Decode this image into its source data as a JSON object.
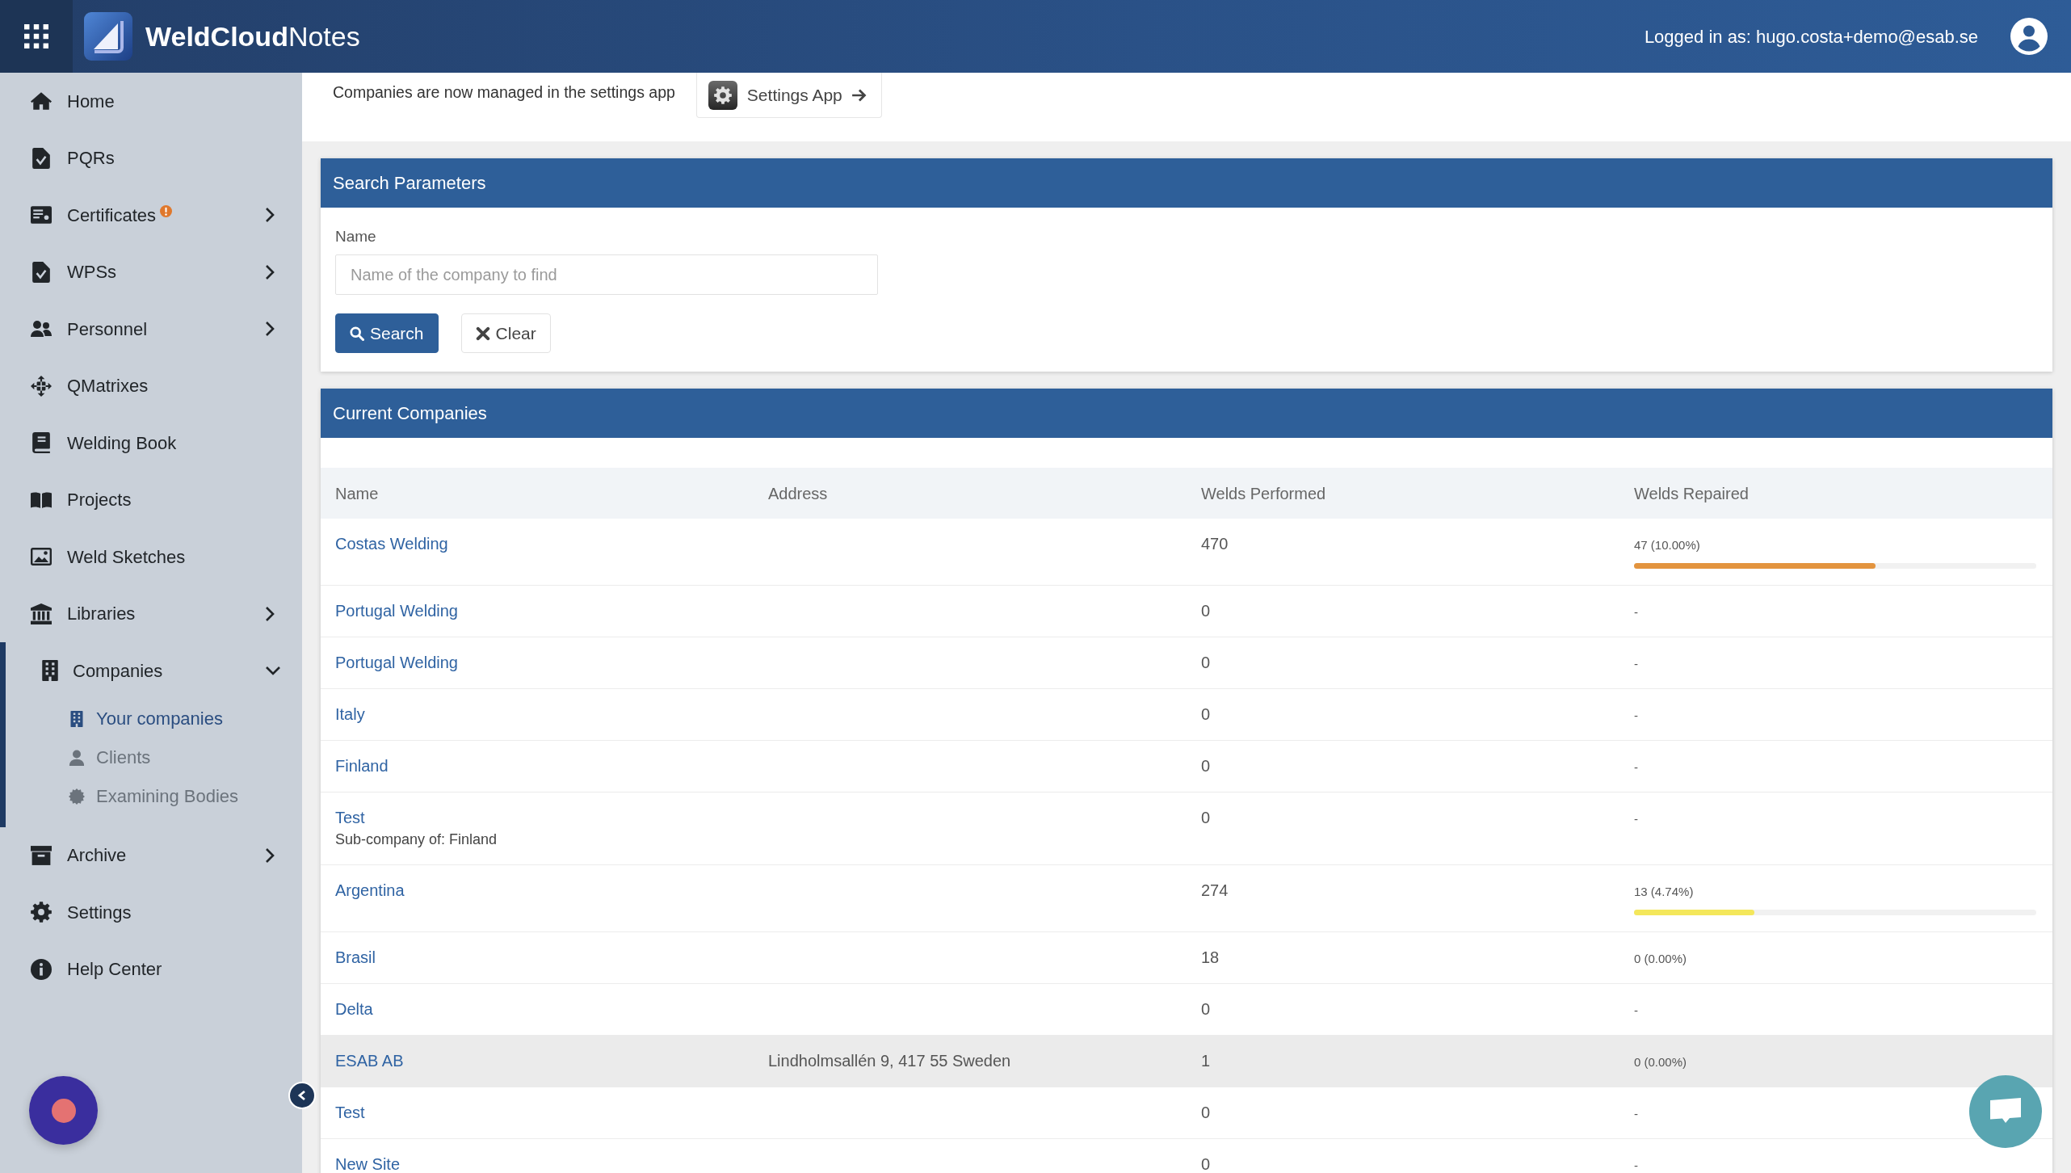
{
  "topbar": {
    "brand": "**WeldCloud**Notes",
    "user": "Logged in as: hugo.costa+demo@esab.se"
  },
  "sidebar": {
    "items": [
      {
        "label": "Home",
        "kind": "link",
        "selected": false,
        "alert": false
      },
      {
        "label": "PQRs",
        "kind": "link",
        "selected": false,
        "alert": false
      },
      {
        "label": "Certificates",
        "kind": "group",
        "selected": false,
        "alert": true,
        "expanded": false
      },
      {
        "label": "WPSs",
        "kind": "group",
        "selected": false,
        "alert": false,
        "expanded": false
      },
      {
        "label": "Personnel",
        "kind": "group",
        "selected": false,
        "alert": false,
        "expanded": false
      },
      {
        "label": "QMatrixes",
        "kind": "link",
        "selected": false,
        "alert": false
      },
      {
        "label": "Welding Book",
        "kind": "link",
        "selected": false,
        "alert": false
      },
      {
        "label": "Projects",
        "kind": "link",
        "selected": false,
        "alert": false
      },
      {
        "label": "Weld Sketches",
        "kind": "link",
        "selected": false,
        "alert": false
      },
      {
        "label": "Libraries",
        "kind": "group",
        "selected": false,
        "alert": false,
        "expanded": false
      },
      {
        "label": "Companies",
        "kind": "group",
        "selected": true,
        "alert": false,
        "expanded": true,
        "children": [
          {
            "label": "Your companies",
            "selected": true
          },
          {
            "label": "Clients",
            "selected": false
          },
          {
            "label": "Examining Bodies",
            "selected": false
          }
        ]
      },
      {
        "label": "Archive",
        "kind": "group",
        "selected": false,
        "alert": false,
        "expanded": false
      },
      {
        "label": "Settings",
        "kind": "link",
        "selected": false,
        "alert": false
      },
      {
        "label": "Help Center",
        "kind": "link",
        "selected": false,
        "alert": false
      }
    ]
  },
  "notice": {
    "text": "Companies are now managed in the settings app",
    "button": "Settings App"
  },
  "search_panel": {
    "title": "Search Parameters",
    "field": {
      "label": "Name",
      "placeholder": "Name of the company to find"
    },
    "buttons": [
      {
        "label": "Search",
        "kind": "primary"
      },
      {
        "label": "Clear",
        "kind": "secondary"
      }
    ]
  },
  "companies": {
    "title": "Current Companies",
    "columns": [
      "Name",
      "Address",
      "Welds Performed",
      "Welds Repaired"
    ],
    "rows": [
      {
        "name": "Costas Welding",
        "welds_performed": "470",
        "welds_repaired": {
          "text": "47 (10.00%)",
          "level": 0.6,
          "color": "#e3943f"
        },
        "highlighted": false
      },
      {
        "name": "Portugal Welding",
        "welds_performed": "0",
        "welds_repaired": {
          "text": "-"
        },
        "highlighted": false
      },
      {
        "name": "Portugal Welding",
        "welds_performed": "0",
        "welds_repaired": {
          "text": "-"
        },
        "highlighted": false
      },
      {
        "name": "Italy",
        "welds_performed": "0",
        "welds_repaired": {
          "text": "-"
        },
        "highlighted": false
      },
      {
        "name": "Finland",
        "welds_performed": "0",
        "welds_repaired": {
          "text": "-"
        },
        "highlighted": false
      },
      {
        "name": "Test",
        "subtitle": "Sub-company of: Finland",
        "welds_performed": "0",
        "welds_repaired": {
          "text": "-"
        },
        "highlighted": false
      },
      {
        "name": "Argentina",
        "welds_performed": "274",
        "welds_repaired": {
          "text": "13 (4.74%)",
          "level": 0.3,
          "color": "#f4e75b"
        },
        "highlighted": false
      },
      {
        "name": "Brasil",
        "welds_performed": "18",
        "welds_repaired": {
          "text": "0 (0.00%)"
        },
        "highlighted": false
      },
      {
        "name": "Delta",
        "welds_performed": "0",
        "welds_repaired": {
          "text": "-"
        },
        "highlighted": false
      },
      {
        "name": "ESAB AB",
        "address": "Lindholmsallén 9, 417 55 Sweden",
        "welds_performed": "1",
        "welds_repaired": {
          "text": "0 (0.00%)"
        },
        "highlighted": true
      },
      {
        "name": "Test",
        "welds_performed": "0",
        "welds_repaired": {
          "text": "-"
        },
        "highlighted": false
      },
      {
        "name": "New Site",
        "welds_performed": "0",
        "welds_repaired": {
          "text": "-"
        },
        "highlighted": false
      }
    ]
  }
}
